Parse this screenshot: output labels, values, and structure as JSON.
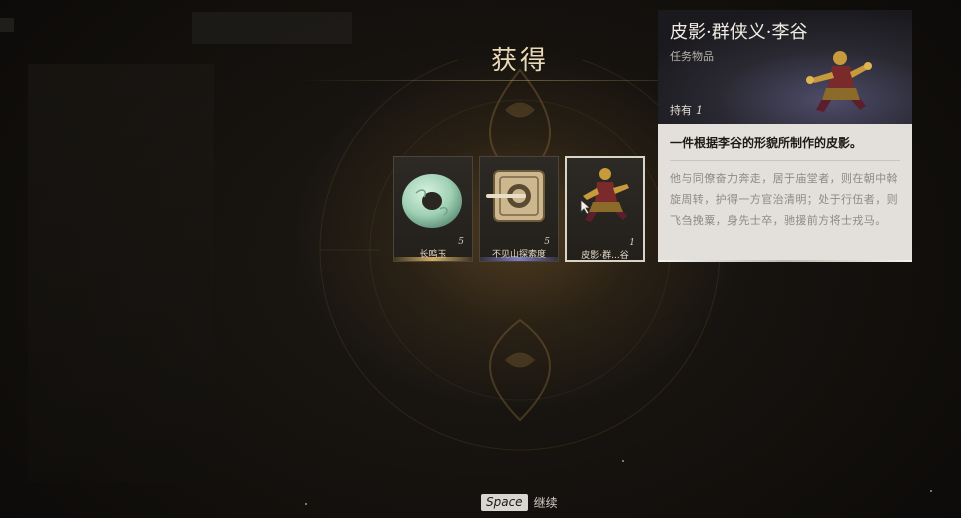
{
  "title": "获得",
  "items": [
    {
      "name": "长鸣玉",
      "count": "5",
      "icon": "jade-ring-icon"
    },
    {
      "name": "不见山探索度",
      "count": "5",
      "icon": "square-seal-icon"
    },
    {
      "name": "皮影·群...谷",
      "count": "1",
      "icon": "shadow-puppet-icon"
    }
  ],
  "selected_index": 2,
  "tooltip": {
    "name": "皮影·群侠义·李谷",
    "type": "任务物品",
    "hold_label": "持有",
    "hold_value": "1",
    "summary": "一件根据李谷的形貌所制作的皮影。",
    "description": "他与同僚奋力奔走，居于庙堂者，则在朝中斡旋周转，护得一方官治清明；处于行伍者，则飞刍挽粟，身先士卒，驰援前方将士戎马。"
  },
  "prompt": {
    "key": "Space",
    "label": "继续"
  },
  "colors": {
    "title": "#e8d9b8",
    "rarity_gold": "#e6be6e",
    "tooltip_bg": "#e3e0dc"
  }
}
